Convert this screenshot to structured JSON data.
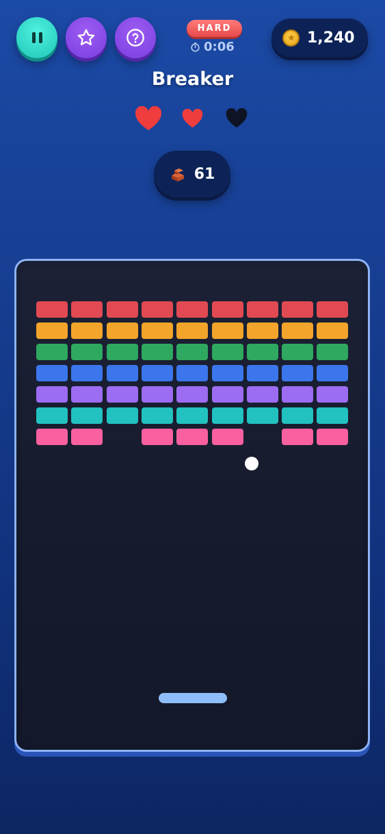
{
  "header": {
    "difficulty": "HARD",
    "timer": "0:06",
    "coins": "1,240",
    "title": "Breaker"
  },
  "buttons": {
    "pause_icon": "pause-icon",
    "favorite_icon": "star-icon",
    "help_icon": "question-icon"
  },
  "lives": {
    "total": 3,
    "remaining": 2,
    "icon": "heart-icon"
  },
  "bricks_remaining": "61",
  "colors": {
    "accent_teal": "#2ad6c6",
    "accent_purple": "#8a4ce8",
    "danger": "#e84a4a",
    "paddle": "#8fbdf9",
    "ball": "#ffffff"
  },
  "bricks": {
    "rows": 7,
    "columns": 9,
    "row_colors": [
      "#e14a52",
      "#f3a42a",
      "#2fa860",
      "#3b76ec",
      "#9c6cf2",
      "#21c2c0",
      "#f8609f"
    ],
    "grid": [
      [
        1,
        1,
        1,
        1,
        1,
        1,
        1,
        1,
        1
      ],
      [
        1,
        1,
        1,
        1,
        1,
        1,
        1,
        1,
        1
      ],
      [
        1,
        1,
        1,
        1,
        1,
        1,
        1,
        1,
        1
      ],
      [
        1,
        1,
        1,
        1,
        1,
        1,
        1,
        1,
        1
      ],
      [
        1,
        1,
        1,
        1,
        1,
        1,
        1,
        1,
        1
      ],
      [
        1,
        1,
        1,
        1,
        1,
        1,
        1,
        1,
        1
      ],
      [
        1,
        1,
        0,
        1,
        1,
        1,
        0,
        1,
        1
      ]
    ]
  }
}
